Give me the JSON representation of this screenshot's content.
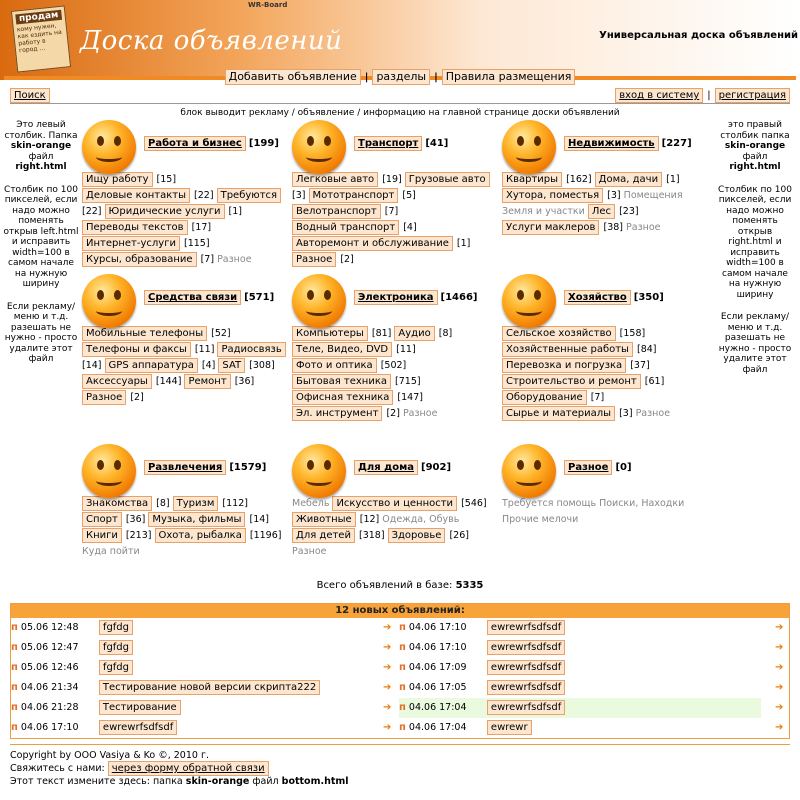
{
  "header": {
    "wr_label": "WR-Board",
    "note_title": "продам",
    "note_text": "кому нужен, как ездить на работу в город ...",
    "logo_text": "Доска объявлений",
    "tagline": "Универсальная доска объявлений"
  },
  "topnav": {
    "add": "Добавить объявление",
    "sections": "разделы",
    "rules": "Правила размещения"
  },
  "search_label": "Поиск",
  "login_label": "вход в систему",
  "register_label": "регистрация",
  "block_text": "блок выводит рекламу / объявление / информацию на главной странице доски объявлений",
  "left_side": {
    "p1a": "Это левый столбик. Папка",
    "skin": "skin-orange",
    "p1b": "файл",
    "file": "right.html",
    "p2": "Столбик по 100 пикселей, если надо можно поменять открыв left.html и исправить width=100 в самом начале на нужную ширину",
    "p3": "Если рекламу/меню и т.д. разешать не нужно - просто удалите этот файл"
  },
  "right_side": {
    "p1a": "это правый столбик папка",
    "skin": "skin-orange",
    "p1b": "файл",
    "file": "right.html",
    "p2": "Столбик по 100 пикселей, если надо можно поменять открыв right.html и исправить width=100 в самом начале на нужную ширину",
    "p3": "Если рекламу/меню и т.д. разешать не нужно - просто удалите этот файл"
  },
  "categories": [
    {
      "name": "Работа и бизнес",
      "count": "[199]",
      "items": [
        {
          "l": "Ищу работу",
          "c": "[15]"
        },
        {
          "l": "Деловые контакты",
          "c": "[22]"
        },
        {
          "l": "Требуются",
          "c": "[22]"
        },
        {
          "l": "Юридические услуги",
          "c": "[1]"
        },
        {
          "l": "Переводы текстов",
          "c": "[17]"
        },
        {
          "l": "Интернет-услуги",
          "c": "[115]"
        },
        {
          "l": "Курсы, образование",
          "c": "[7]"
        }
      ],
      "extra": "Разное"
    },
    {
      "name": "Транспорт",
      "count": "[41]",
      "items": [
        {
          "l": "Легковые авто",
          "c": "[19]"
        },
        {
          "l": "Грузовые авто",
          "c": "[3]"
        },
        {
          "l": "Мототранспорт",
          "c": "[5]"
        },
        {
          "l": "Велотранспорт",
          "c": "[7]"
        },
        {
          "l": "Водный транспорт",
          "c": "[4]"
        },
        {
          "l": "Авторемонт и обслуживание",
          "c": "[1]"
        },
        {
          "l": "Разное",
          "c": "[2]"
        }
      ],
      "extra": ""
    },
    {
      "name": "Недвижимость",
      "count": "[227]",
      "items": [
        {
          "l": "Квартиры",
          "c": "[162]"
        },
        {
          "l": "Дома, дачи",
          "c": "[1]"
        },
        {
          "l": "Хутора, поместья",
          "c": "[3]"
        }
      ],
      "extra": "Помещения  Земля и участки",
      "items2": [
        {
          "l": "Лес",
          "c": "[23]"
        },
        {
          "l": "Услуги маклеров",
          "c": "[38]"
        }
      ],
      "extra2": "Разное"
    },
    {
      "name": "Средства связи",
      "count": "[571]",
      "items": [
        {
          "l": "Мобильные телефоны",
          "c": "[52]"
        },
        {
          "l": "Телефоны и факсы",
          "c": "[11]"
        },
        {
          "l": "Радиосвязь",
          "c": "[14]"
        },
        {
          "l": "GPS аппаратура",
          "c": "[4]"
        },
        {
          "l": "SAT",
          "c": "[308]"
        },
        {
          "l": "Аксессуары",
          "c": "[144]"
        },
        {
          "l": "Ремонт",
          "c": "[36]"
        },
        {
          "l": "Разное",
          "c": "[2]"
        }
      ],
      "extra": ""
    },
    {
      "name": "Электроника",
      "count": "[1466]",
      "items": [
        {
          "l": "Компьютеры",
          "c": "[81]"
        },
        {
          "l": "Аудио",
          "c": "[8]"
        },
        {
          "l": "Теле, Видео, DVD",
          "c": "[11]"
        },
        {
          "l": "Фото и оптика",
          "c": "[502]"
        },
        {
          "l": "Бытовая техника",
          "c": "[715]"
        },
        {
          "l": "Офисная техника",
          "c": "[147]"
        },
        {
          "l": "Эл. инструмент",
          "c": "[2]"
        }
      ],
      "extra": "Разное"
    },
    {
      "name": "Хозяйство",
      "count": "[350]",
      "items": [
        {
          "l": "Сельское хозяйство",
          "c": "[158]"
        },
        {
          "l": "Хозяйственные работы",
          "c": "[84]"
        },
        {
          "l": "Перевозка и погрузка",
          "c": "[37]"
        },
        {
          "l": "Строительство и ремонт",
          "c": "[61]"
        },
        {
          "l": "Оборудование",
          "c": "[7]"
        },
        {
          "l": "Сырье и материалы",
          "c": "[3]"
        }
      ],
      "extra": "Разное"
    },
    {
      "name": "Развлечения",
      "count": "[1579]",
      "items": [
        {
          "l": "Знакомства",
          "c": "[8]"
        },
        {
          "l": "Туризм",
          "c": "[112]"
        },
        {
          "l": "Спорт",
          "c": "[36]"
        },
        {
          "l": "Музыка, фильмы",
          "c": "[14]"
        },
        {
          "l": "Книги",
          "c": "[213]"
        },
        {
          "l": "Охота, рыбалка",
          "c": "[1196]"
        }
      ],
      "extra": "Куда пойти"
    },
    {
      "name": "Для дома",
      "count": "[902]",
      "pre": "Мебель",
      "items": [
        {
          "l": "Искусство и ценности",
          "c": "[546]"
        },
        {
          "l": "Животные",
          "c": "[12]"
        }
      ],
      "extra": "Одежда, Обувь",
      "items2": [
        {
          "l": "Для детей",
          "c": "[318]"
        },
        {
          "l": "Здоровье",
          "c": "[26]"
        }
      ],
      "extra2": "Разное"
    },
    {
      "name": "Разное",
      "count": "[0]",
      "items": [],
      "extra": "Требуется помощь   Поиски, Находки   Прочие мелочи"
    }
  ],
  "total_label": "Всего объявлений в базе:",
  "total_value": "5335",
  "new_header": "12 новых объявлений:",
  "new_left": [
    {
      "d": "05.06 12:48",
      "t": "fgfdg"
    },
    {
      "d": "05.06 12:47",
      "t": "fgfdg"
    },
    {
      "d": "05.06 12:46",
      "t": "fgfdg"
    },
    {
      "d": "04.06 21:34",
      "t": "Тестирование новой версии скрипта222"
    },
    {
      "d": "04.06 21:28",
      "t": "Тестирование"
    },
    {
      "d": "04.06 17:10",
      "t": "ewrewrfsdfsdf"
    }
  ],
  "new_right": [
    {
      "d": "04.06 17:10",
      "t": "ewrewrfsdfsdf"
    },
    {
      "d": "04.06 17:10",
      "t": "ewrewrfsdfsdf"
    },
    {
      "d": "04.06 17:09",
      "t": "ewrewrfsdfsdf"
    },
    {
      "d": "04.06 17:05",
      "t": "ewrewrfsdfsdf"
    },
    {
      "d": "04.06 17:04",
      "t": "ewrewrfsdfsdf"
    },
    {
      "d": "04.06 17:04",
      "t": "ewrewr"
    }
  ],
  "footer": {
    "copyright": "Copyright by ООО Vasiya & Ko ©, 2010 г.",
    "contact": "Свяжитесь с нами:",
    "contact_link": "через форму обратной связи",
    "edit_a": "Этот текст измените здесь: папка",
    "skin": "skin-orange",
    "edit_b": "файл",
    "file": "bottom.html"
  }
}
